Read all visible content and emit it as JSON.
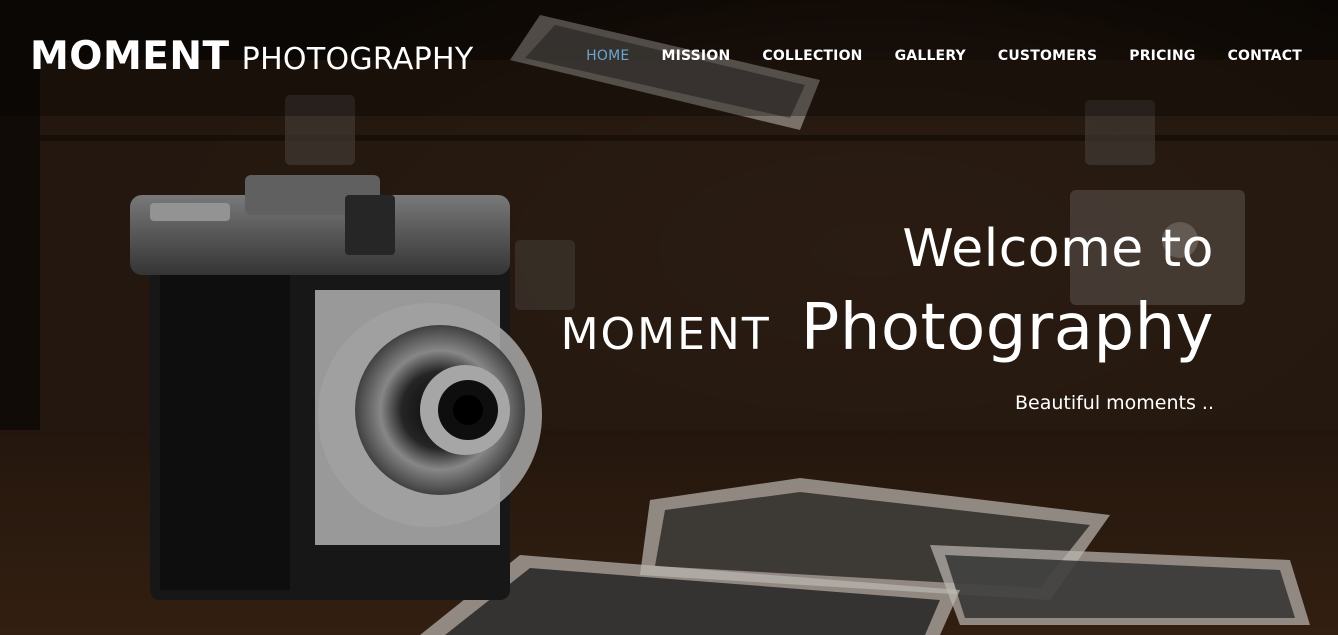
{
  "brand": {
    "strong": "MOMENT",
    "light": "PHOTOGRAPHY"
  },
  "nav": {
    "items": [
      "HOME",
      "MISSION",
      "COLLECTION",
      "GALLERY",
      "CUSTOMERS",
      "PRICING",
      "CONTACT"
    ],
    "active": "HOME"
  },
  "hero": {
    "line1": "Welcome to",
    "line2_caps": "MOMENT",
    "line2_big": "Photography",
    "tagline": "Beautiful moments .."
  },
  "colors": {
    "nav_active": "#6aa6d3",
    "text": "#ffffff",
    "navbar_bg": "rgba(0,0,0,0.30)"
  }
}
